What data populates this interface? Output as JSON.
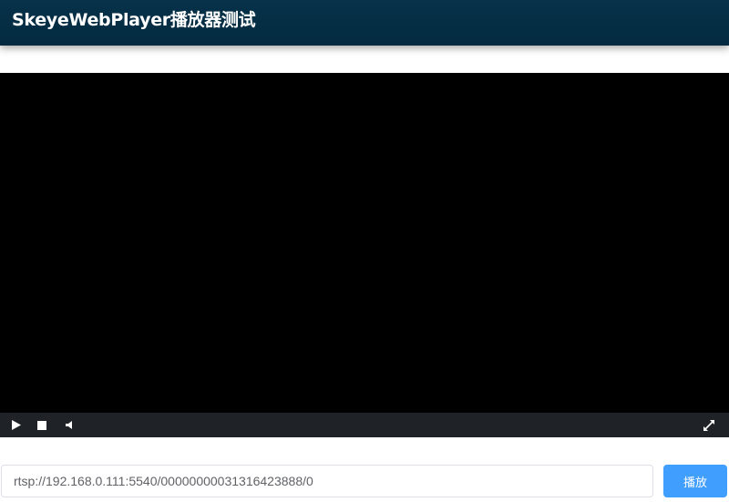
{
  "header": {
    "title": "SkeyeWebPlayer播放器测试"
  },
  "player": {
    "controls": {
      "play_icon": "play-icon",
      "stop_icon": "stop-icon",
      "volume_icon": "volume-icon",
      "fullscreen_icon": "fullscreen-icon"
    }
  },
  "url_bar": {
    "value": "rtsp://192.168.0.111:5540/00000000031316423888/0",
    "play_label": "播放"
  },
  "colors": {
    "header_bg": "#032a40",
    "video_bg": "#000000",
    "controls_bg": "#1f2328",
    "accent": "#409eff"
  }
}
